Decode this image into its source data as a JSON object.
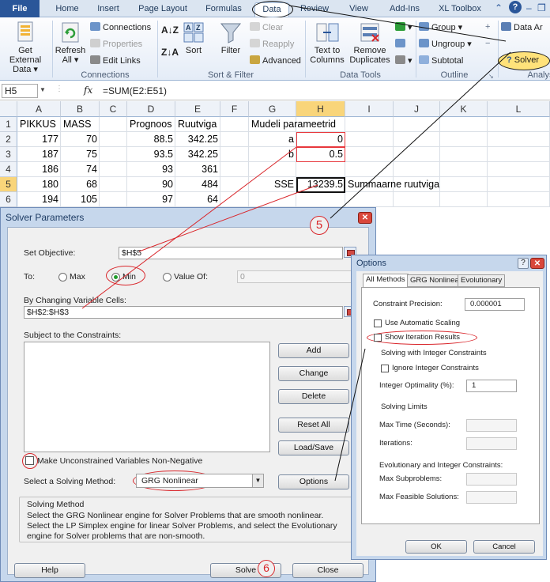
{
  "ribbon": {
    "tabs": [
      "File",
      "Home",
      "Insert",
      "Page Layout",
      "Formulas",
      "Data",
      "Review",
      "View",
      "Add-Ins",
      "XL Toolbox"
    ],
    "active_tab": "Data",
    "get_external_data": "Get External Data",
    "refresh_all": "Refresh All",
    "connections": "Connections",
    "properties": "Properties",
    "edit_links": "Edit Links",
    "group_connections": "Connections",
    "sort_az": "A Z",
    "sort": "Sort",
    "filter": "Filter",
    "clear": "Clear",
    "reapply": "Reapply",
    "advanced": "Advanced",
    "group_sort_filter": "Sort & Filter",
    "text_to_columns": "Text to Columns",
    "remove_duplicates": "Remove Duplicates",
    "group_data_tools": "Data Tools",
    "group_btn": "Group",
    "ungroup_btn": "Ungroup",
    "subtotal": "Subtotal",
    "group_outline": "Outline",
    "data_analysis": "Data Ar",
    "solver": "Solver",
    "group_analysis": "Analys"
  },
  "formula_bar": {
    "name_box": "H5",
    "fx": "fx",
    "formula": "=SUM(E2:E51)"
  },
  "sheet": {
    "columns": [
      "A",
      "B",
      "C",
      "D",
      "E",
      "F",
      "G",
      "H",
      "I",
      "J",
      "K",
      "L"
    ],
    "rows": [
      "1",
      "2",
      "3",
      "4",
      "5",
      "6"
    ],
    "cells": {
      "A1": "PIKKUS",
      "B1": "MASS",
      "D1": "Prognoos",
      "E1": "Ruutviga",
      "G1": "Mudeli parameetrid",
      "A2": "177",
      "B2": "70",
      "D2": "88.5",
      "E2": "342.25",
      "G2": "a",
      "H2": "0",
      "A3": "187",
      "B3": "75",
      "D3": "93.5",
      "E3": "342.25",
      "G3": "b",
      "H3": "0.5",
      "A4": "186",
      "B4": "74",
      "D4": "93",
      "E4": "361",
      "A5": "180",
      "B5": "68",
      "D5": "90",
      "E5": "484",
      "G5": "SSE",
      "H5": "13239.5",
      "I5": "Summaarne ruutviga",
      "A6": "194",
      "B6": "105",
      "D6": "97",
      "E6": "64"
    }
  },
  "solver": {
    "title": "Solver Parameters",
    "set_objective_label": "Set Objective:",
    "objective": "$H$5",
    "to_label": "To:",
    "max": "Max",
    "min": "Min",
    "value_of": "Value Of:",
    "value_of_value": "0",
    "changing_label": "By Changing Variable Cells:",
    "changing": "$H$2:$H$3",
    "constraints_label": "Subject to the Constraints:",
    "add": "Add",
    "change": "Change",
    "delete": "Delete",
    "reset_all": "Reset All",
    "load_save": "Load/Save",
    "nonneg": "Make Unconstrained Variables Non-Negative",
    "method_label": "Select a Solving Method:",
    "method": "GRG Nonlinear",
    "options": "Options",
    "solving_method_title": "Solving Method",
    "description": "Select the GRG Nonlinear engine for Solver Problems that are smooth nonlinear. Select the LP Simplex engine for linear Solver Problems, and select the Evolutionary engine for Solver problems that are non-smooth.",
    "help": "Help",
    "solve": "Solve",
    "close": "Close"
  },
  "options": {
    "title": "Options",
    "help_icon": "?",
    "tabs": [
      "All Methods",
      "GRG Nonlinear",
      "Evolutionary"
    ],
    "constraint_precision_label": "Constraint Precision:",
    "constraint_precision": "0.000001",
    "auto_scaling": "Use Automatic Scaling",
    "show_iterations": "Show Iteration Results",
    "solving_integer": "Solving with Integer Constraints",
    "ignore_integer": "Ignore Integer Constraints",
    "integer_optimality_label": "Integer Optimality (%):",
    "integer_optimality": "1",
    "solving_limits": "Solving Limits",
    "max_time": "Max Time (Seconds):",
    "iterations": "Iterations:",
    "evo_int_title": "Evolutionary and Integer Constraints:",
    "max_subproblems": "Max Subproblems:",
    "max_feasible": "Max Feasible Solutions:",
    "ok": "OK",
    "cancel": "Cancel"
  },
  "annotations": {
    "step5": "5",
    "step6": "6"
  },
  "colors": {
    "annotation_red": "#d9262b",
    "file_tab": "#2a5699",
    "selection_orange": "#f9d57a"
  }
}
